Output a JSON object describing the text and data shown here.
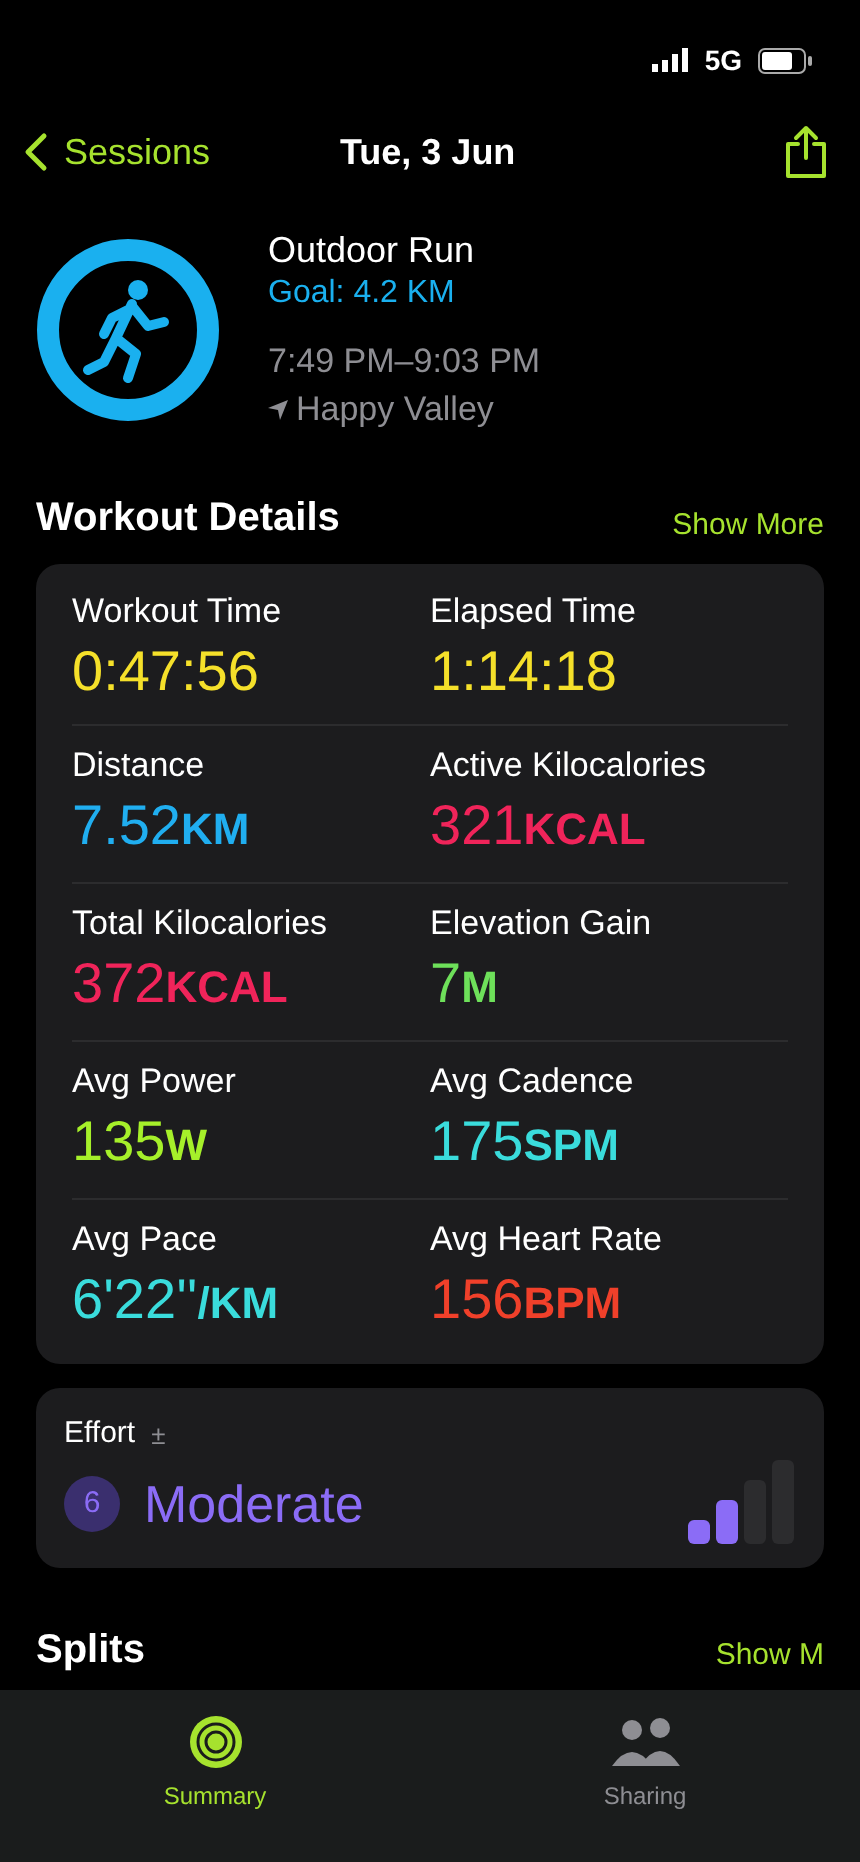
{
  "status_bar": {
    "network": "5G"
  },
  "nav": {
    "back": "Sessions",
    "title": "Tue, 3 Jun"
  },
  "workout": {
    "name": "Outdoor Run",
    "goal": "Goal: 4.2 KM",
    "time": "7:49 PM–9:03 PM",
    "location": "Happy Valley"
  },
  "details": {
    "title": "Workout Details",
    "action": "Show More",
    "metrics": [
      {
        "label": "Workout Time",
        "value": "0:47:56",
        "color": "#f5e02a"
      },
      {
        "label": "Elapsed Time",
        "value": "1:14:18",
        "color": "#f5e02a"
      },
      {
        "label": "Distance",
        "value": "7.52",
        "unit": "KM",
        "color": "#20aef0"
      },
      {
        "label": "Active Kilocalories",
        "value": "321",
        "unit": "KCAL",
        "color": "#f0245a"
      },
      {
        "label": "Total Kilocalories",
        "value": "372",
        "unit": "KCAL",
        "color": "#f0245a"
      },
      {
        "label": "Elevation Gain",
        "value": "7",
        "unit": "M",
        "color": "#6ee05a"
      },
      {
        "label": "Avg Power",
        "value": "135",
        "unit": "W",
        "color": "#a6f02a"
      },
      {
        "label": "Avg Cadence",
        "value": "175",
        "unit": "SPM",
        "color": "#3adcdc"
      },
      {
        "label": "Avg Pace",
        "value": "6'22''",
        "unit": "/KM",
        "color": "#3adcdc"
      },
      {
        "label": "Avg Heart Rate",
        "value": "156",
        "unit": "BPM",
        "color": "#f0402a"
      }
    ]
  },
  "effort": {
    "label": "Effort",
    "adjust": "±",
    "score": "6",
    "rating": "Moderate",
    "level": 0.5
  },
  "splits": {
    "title": "Splits",
    "action": "Show M"
  },
  "tabs": [
    {
      "label": "Summary",
      "selected": true
    },
    {
      "label": "Sharing",
      "selected": false
    }
  ]
}
